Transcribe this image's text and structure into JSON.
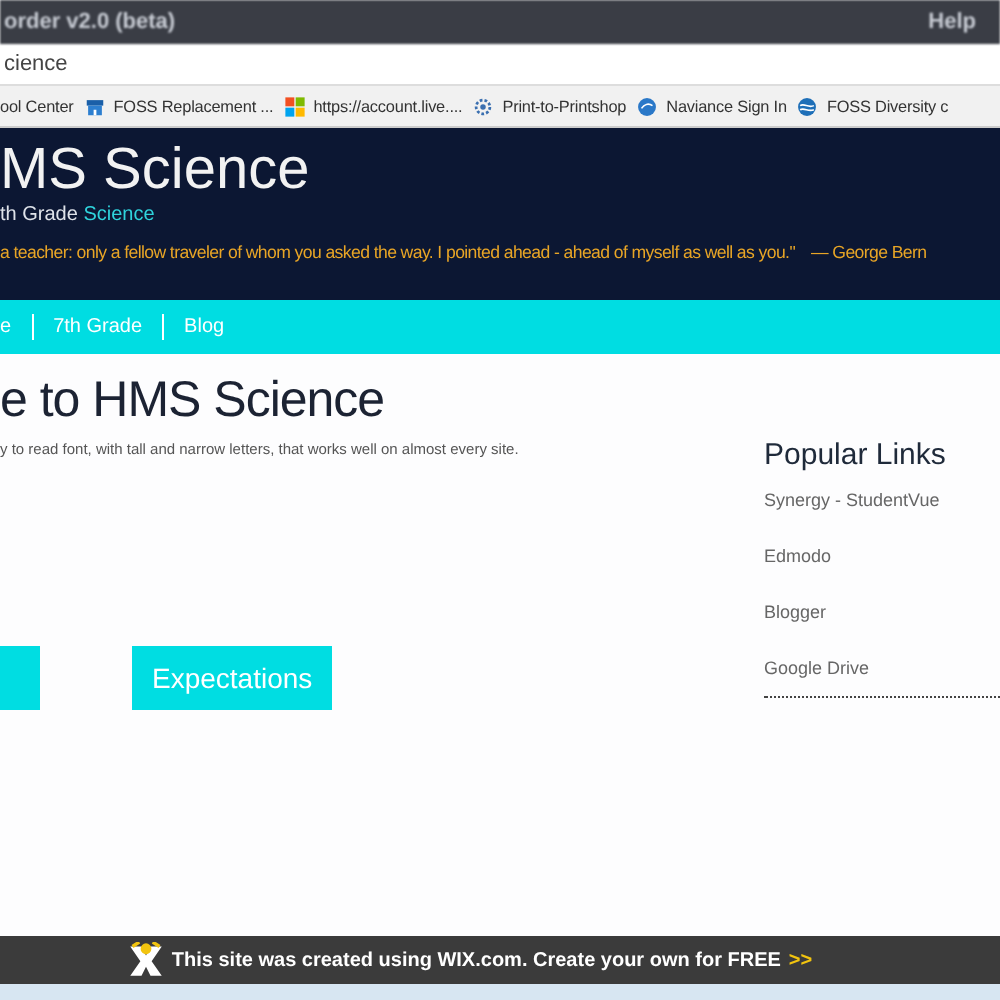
{
  "window": {
    "title": "order v2.0 (beta)",
    "help": "Help"
  },
  "address_bar": {
    "value": "cience"
  },
  "bookmarks": [
    {
      "label": "ool Center",
      "kind": "none"
    },
    {
      "label": "FOSS Replacement ...",
      "kind": "store"
    },
    {
      "label": "https://account.live....",
      "kind": "tiles"
    },
    {
      "label": "Print-to-Printshop",
      "kind": "gear"
    },
    {
      "label": "Naviance Sign In",
      "kind": "globe"
    },
    {
      "label": "FOSS Diversity c",
      "kind": "wave"
    }
  ],
  "site_header": {
    "title": "MS Science",
    "subtitle": "th Grade **Science**",
    "quote": "a teacher: only a fellow traveler of whom you asked the way. I pointed ahead - ahead of myself as well as you.\"",
    "author": "— George Bern"
  },
  "nav": [
    {
      "label": "e"
    },
    {
      "label": "7th Grade"
    },
    {
      "label": "Blog"
    }
  ],
  "main": {
    "heading": "e to HMS Science",
    "intro": "y to read font, with tall and narrow letters, that works well on almost every site.",
    "buttons": [
      {
        "kind": "cut"
      },
      {
        "kind": "full",
        "label": "Expectations"
      }
    ]
  },
  "sidebar": {
    "title": "Popular Links",
    "links": [
      "Synergy - StudentVue",
      "Edmodo",
      "Blogger",
      "Google Drive"
    ]
  },
  "wix_banner": {
    "text": "This site was created using WIX.com. Create your own for FREE",
    "arrows": ">>"
  }
}
